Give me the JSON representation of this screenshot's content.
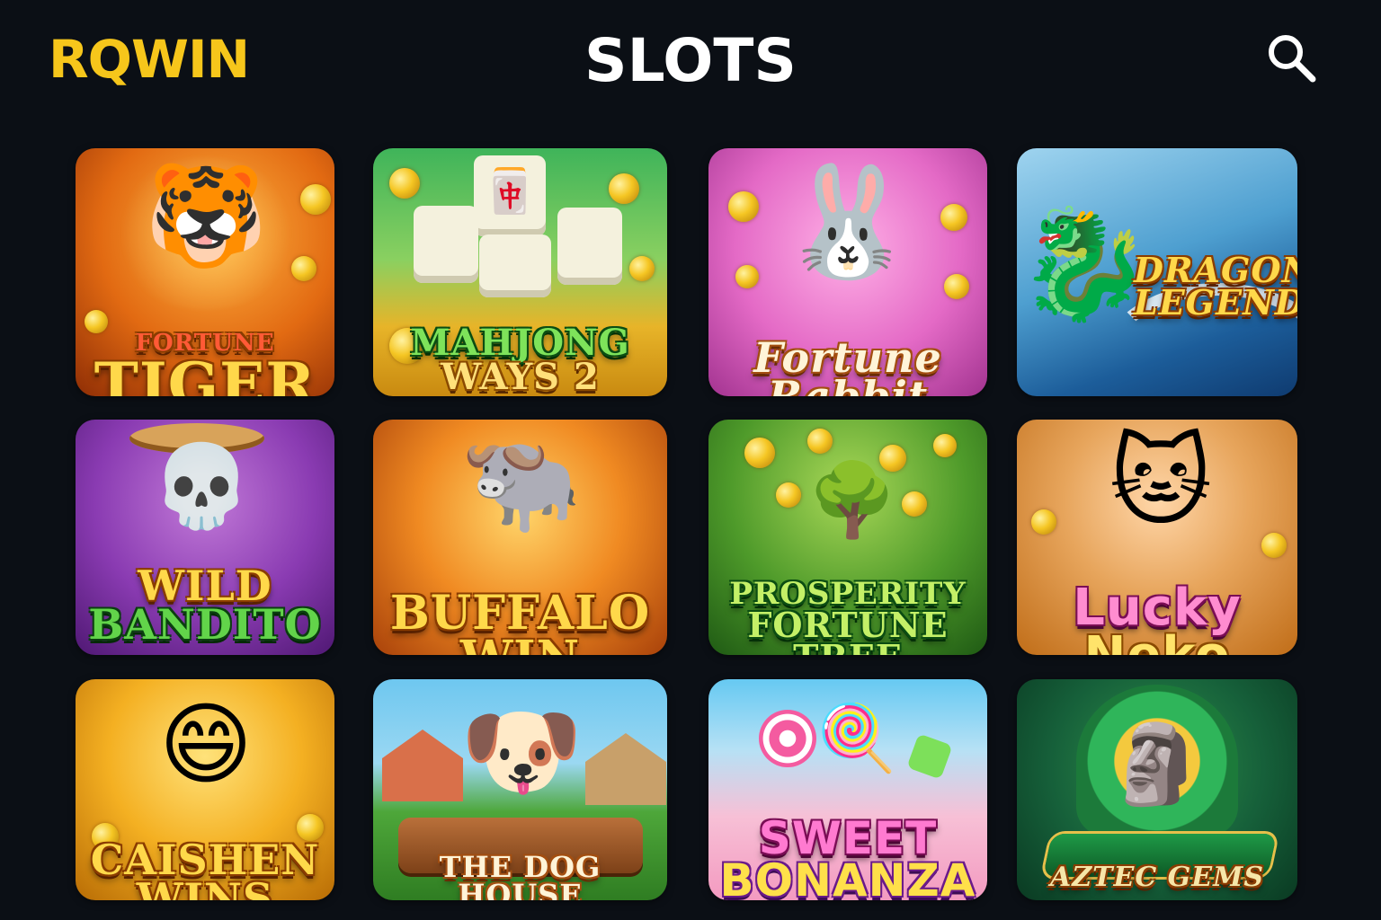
{
  "header": {
    "logo_text": "RQWIN",
    "title": "SLOTS",
    "search_icon": "search-icon",
    "colors": {
      "background": "#0b0f15",
      "logo": "#f6c61b",
      "title": "#ffffff"
    }
  },
  "games": [
    {
      "id": "fortune-tiger",
      "title_line1": "FORTUNE",
      "title_line2": "TIGER",
      "mascot": "🐯"
    },
    {
      "id": "mahjong-ways-2",
      "title_line1": "MAHJONG",
      "title_line2": "WAYS 2",
      "mascot": "🀄"
    },
    {
      "id": "fortune-rabbit",
      "title_line1": "Fortune",
      "title_line2": "Rabbit",
      "mascot": "🐰"
    },
    {
      "id": "dragon-legend",
      "title_line1": "DRAGON",
      "title_line2": "LEGEND",
      "mascot": "🐉"
    },
    {
      "id": "wild-bandito",
      "title_line1": "WILD",
      "title_line2": "BANDITO",
      "mascot": "💀"
    },
    {
      "id": "buffalo-win",
      "title_line1": "BUFFALO",
      "title_line2": "WIN",
      "mascot": "🐃"
    },
    {
      "id": "prosperity-fortune-tree",
      "title_line1": "PROSPERITY",
      "title_line2": "FORTUNE TREE",
      "mascot": "🌳"
    },
    {
      "id": "lucky-neko",
      "title_line1": "Lucky",
      "title_line2": "Neko",
      "mascot": "🐱"
    },
    {
      "id": "caishen-wins",
      "title_line1": "CAISHEN",
      "title_line2": "WINS",
      "mascot": "😄"
    },
    {
      "id": "the-dog-house",
      "title_line1": "THE DOG HOUSE",
      "title_line2": "",
      "mascot": "🐶"
    },
    {
      "id": "sweet-bonanza",
      "title_line1": "SWEET",
      "title_line2": "BONANZA",
      "mascot": "🍭"
    },
    {
      "id": "aztec-gems",
      "title_line1": "AZTEC GEMS",
      "title_line2": "",
      "mascot": "🗿"
    }
  ]
}
